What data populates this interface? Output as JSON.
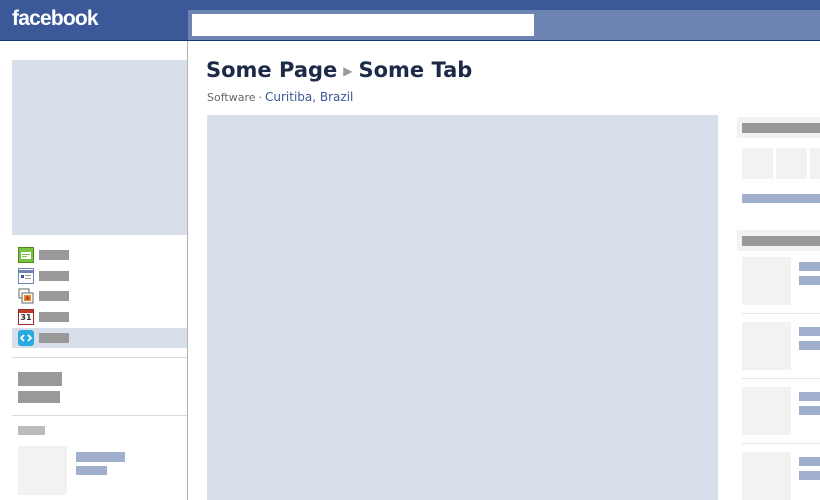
{
  "header": {
    "logo": "facebook",
    "search_value": ""
  },
  "page": {
    "name": "Some Page",
    "tab": "Some Tab",
    "category": "Software",
    "location": "Curitiba, Brazil"
  },
  "sidebar": {
    "items": [
      {
        "icon": "wall-icon",
        "selected": false
      },
      {
        "icon": "info-icon",
        "selected": false
      },
      {
        "icon": "photos-icon",
        "selected": false
      },
      {
        "icon": "events-icon",
        "icon_text": "31",
        "selected": false
      },
      {
        "icon": "app-icon",
        "selected": true
      }
    ]
  },
  "colors": {
    "brand": "#3b5998",
    "topnav": "#6d84b4",
    "placeholder": "#d8dfea",
    "link": "#3b5998"
  }
}
